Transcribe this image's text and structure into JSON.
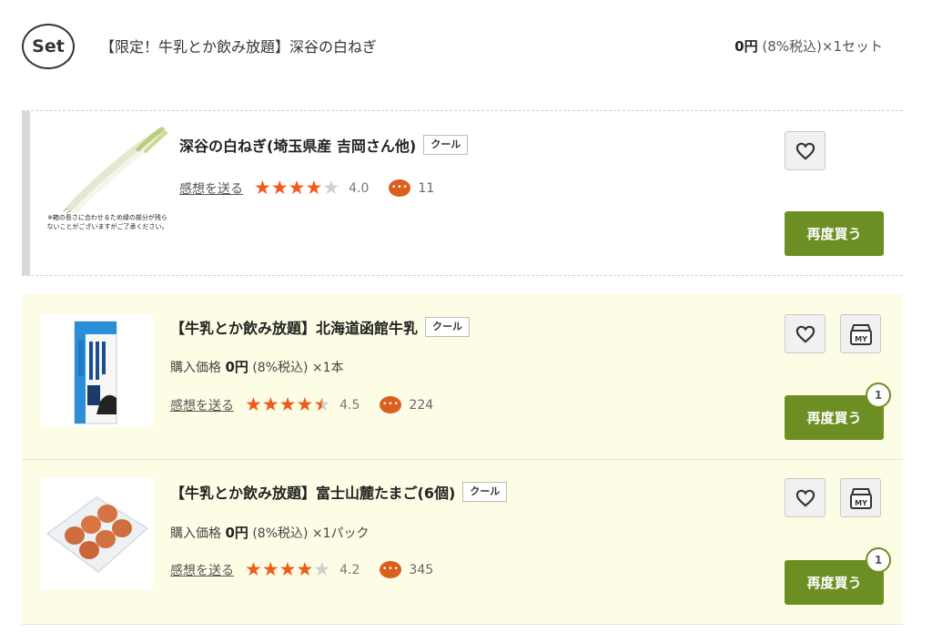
{
  "set": {
    "badge": "Set",
    "title": "【限定！牛乳とか飲み放題】深谷の白ねぎ",
    "price_value": "0円",
    "price_tail": " (8%税込)×1セット"
  },
  "items": [
    {
      "name": "深谷の白ねぎ(埼玉県産 吉岡さん他)",
      "tag": "クール",
      "thumb_note": "※箱の長さに合わせるため緑の部分が残らないことがございますがご了承ください。",
      "purchase_label": "",
      "price_value": "",
      "price_tail": "",
      "review_link": "感想を送る",
      "rating": 4.0,
      "rating_text": "4.0",
      "comment_count": "11",
      "rebuy_label": "再度買う",
      "badge_count": ""
    },
    {
      "name": "【牛乳とか飲み放題】北海道函館牛乳",
      "tag": "クール",
      "purchase_label": "購入価格",
      "price_value": "0円",
      "price_tail": " (8%税込) ×1本",
      "review_link": "感想を送る",
      "rating": 4.5,
      "rating_text": "4.5",
      "comment_count": "224",
      "rebuy_label": "再度買う",
      "badge_count": "1",
      "my_label": "MY"
    },
    {
      "name": "【牛乳とか飲み放題】富士山麓たまご(6個)",
      "tag": "クール",
      "purchase_label": "購入価格",
      "price_value": "0円",
      "price_tail": " (8%税込) ×1パック",
      "review_link": "感想を送る",
      "rating": 4.2,
      "rating_text": "4.2",
      "comment_count": "345",
      "rebuy_label": "再度買う",
      "badge_count": "1",
      "my_label": "MY"
    }
  ],
  "colors": {
    "accent_green": "#6c8e22",
    "star_orange": "#f05a1a",
    "comment_orange": "#d95f1e",
    "row_highlight": "#fdfde6"
  },
  "icons": [
    "heart-icon",
    "my-list-icon",
    "comment-icon",
    "star-icon"
  ]
}
